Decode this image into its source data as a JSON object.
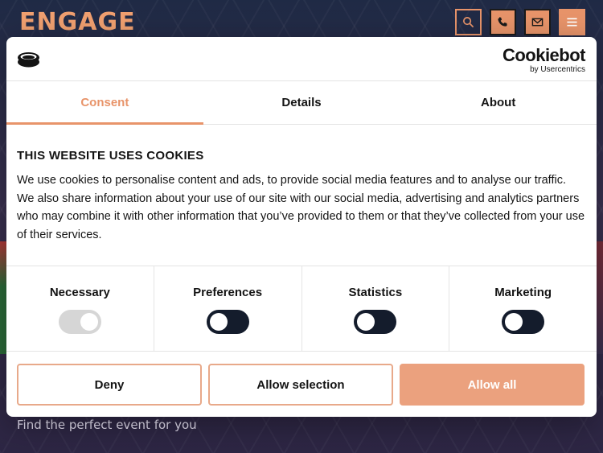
{
  "site": {
    "logo": "ENGAGE",
    "tagline": "Find the perfect event for you"
  },
  "header_buttons": [
    {
      "icon": "search-icon"
    },
    {
      "icon": "phone-icon"
    },
    {
      "icon": "mail-icon"
    },
    {
      "icon": "hamburger-menu-icon"
    }
  ],
  "dialog": {
    "brand": {
      "name": "Cookiebot",
      "sub": "by Usercentrics"
    },
    "tabs": [
      {
        "label": "Consent",
        "active": true
      },
      {
        "label": "Details",
        "active": false
      },
      {
        "label": "About",
        "active": false
      }
    ],
    "title": "THIS WEBSITE USES COOKIES",
    "description": "We use cookies to personalise content and ads, to provide social media features and to analyse our traffic. We also share information about your use of our site with our social media, advertising and analytics partners who may combine it with other information that you’ve provided to them or that they’ve collected from your use of their services.",
    "categories": [
      {
        "label": "Necessary",
        "enabled": true,
        "locked": true
      },
      {
        "label": "Preferences",
        "enabled": false
      },
      {
        "label": "Statistics",
        "enabled": false
      },
      {
        "label": "Marketing",
        "enabled": false
      }
    ],
    "buttons": {
      "deny": "Deny",
      "allow_selection": "Allow selection",
      "allow_all": "Allow all"
    }
  },
  "colors": {
    "accent": "#e8946a",
    "toggle_off": "#141c2c",
    "toggle_locked": "#d6d6d6"
  }
}
